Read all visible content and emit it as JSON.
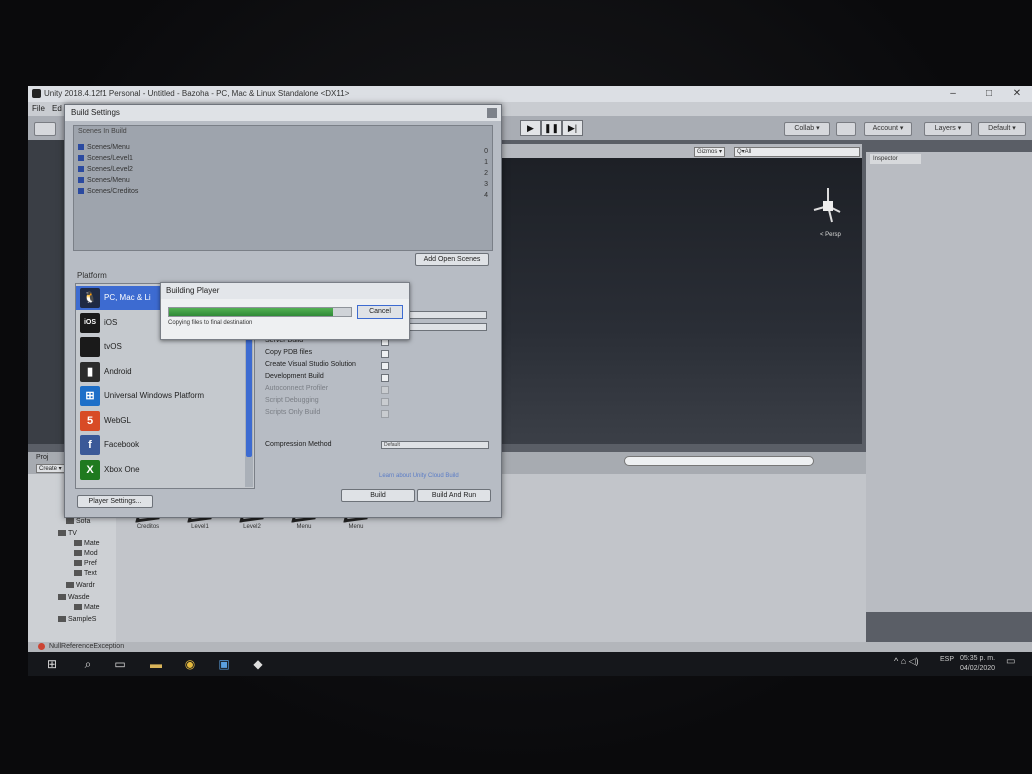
{
  "window": {
    "title": "Unity 2018.4.12f1 Personal - Untitled - Bazoha - PC, Mac & Linux Standalone <DX11>",
    "controls": [
      "–",
      "□",
      "✕"
    ]
  },
  "menu": [
    "File",
    "Ed"
  ],
  "toolbar": {
    "play": "▶",
    "pause": "❚❚",
    "step": "▶|",
    "collab": "Collab ▾",
    "account": "Account ▾",
    "layers": "Layers ▾",
    "layout": "Default ▾"
  },
  "scene": {
    "gizmos": "Gizmos ▾",
    "search_placeholder": "Q▾All",
    "persp": "< Persp",
    "inspector_tab": "Inspector"
  },
  "build_settings": {
    "title": "Build Settings",
    "scenes_header": "Scenes In Build",
    "scenes": [
      {
        "name": "Scenes/Menu",
        "index": "0"
      },
      {
        "name": "Scenes/Level1",
        "index": "1"
      },
      {
        "name": "Scenes/Level2",
        "index": "2"
      },
      {
        "name": "Scenes/Menu",
        "index": "3"
      },
      {
        "name": "Scenes/Creditos",
        "index": "4"
      }
    ],
    "add_open_scenes": "Add Open Scenes",
    "platform_label": "Platform",
    "platforms": [
      {
        "label": "PC, Mac & Li",
        "icon": "linux-icon",
        "glyph": "🐧",
        "color": "#1f2a44",
        "selected": true
      },
      {
        "label": "iOS",
        "icon": "ios-icon",
        "glyph": "iOS",
        "color": "#1a1a1a",
        "selected": false
      },
      {
        "label": "tvOS",
        "icon": "apple-tv-icon",
        "glyph": "",
        "color": "#1a1a1a",
        "selected": false
      },
      {
        "label": "Android",
        "icon": "android-icon",
        "glyph": "▮",
        "color": "#2b2b2b",
        "selected": false
      },
      {
        "label": "Universal Windows Platform",
        "icon": "windows-icon",
        "glyph": "⊞",
        "color": "#1e6fc8",
        "selected": false
      },
      {
        "label": "WebGL",
        "icon": "html5-icon",
        "glyph": "5",
        "color": "#d84b26",
        "selected": false
      },
      {
        "label": "Facebook",
        "icon": "facebook-icon",
        "glyph": "f",
        "color": "#3b5998",
        "selected": false
      },
      {
        "label": "Xbox One",
        "icon": "xbox-icon",
        "glyph": "X",
        "color": "#1f7a1f",
        "selected": false
      }
    ],
    "options": [
      {
        "label": "Server Build",
        "enabled": true
      },
      {
        "label": "Copy PDB files",
        "enabled": true
      },
      {
        "label": "Create Visual Studio Solution",
        "enabled": true
      },
      {
        "label": "Development Build",
        "enabled": true
      },
      {
        "label": "Autoconnect Profiler",
        "enabled": false
      },
      {
        "label": "Script Debugging",
        "enabled": false
      },
      {
        "label": "Scripts Only Build",
        "enabled": false
      }
    ],
    "compression_label": "Compression Method",
    "compression_value": "Default",
    "cloud_link": "Learn about Unity Cloud Build",
    "player_settings": "Player Settings...",
    "build": "Build",
    "build_and_run": "Build And Run"
  },
  "building_player": {
    "title": "Building Player",
    "progress": 0.9,
    "message": "Copying files to final destination",
    "cancel": "Cancel"
  },
  "project": {
    "tab": "Proj",
    "create": "Create ▾",
    "tree": [
      "Sofa",
      "TV",
      "Mate",
      "Mod",
      "Pref",
      "Text",
      "Wardr",
      "Wasde",
      "Mate",
      "SampleS"
    ],
    "assets": [
      "Creditos",
      "Level1",
      "Level2",
      "Menu",
      "Menu"
    ]
  },
  "status": {
    "message": "NullReferenceException"
  },
  "taskbar": {
    "lang": "ESP",
    "time": "05:35 p. m.",
    "date": "04/02/2020"
  }
}
